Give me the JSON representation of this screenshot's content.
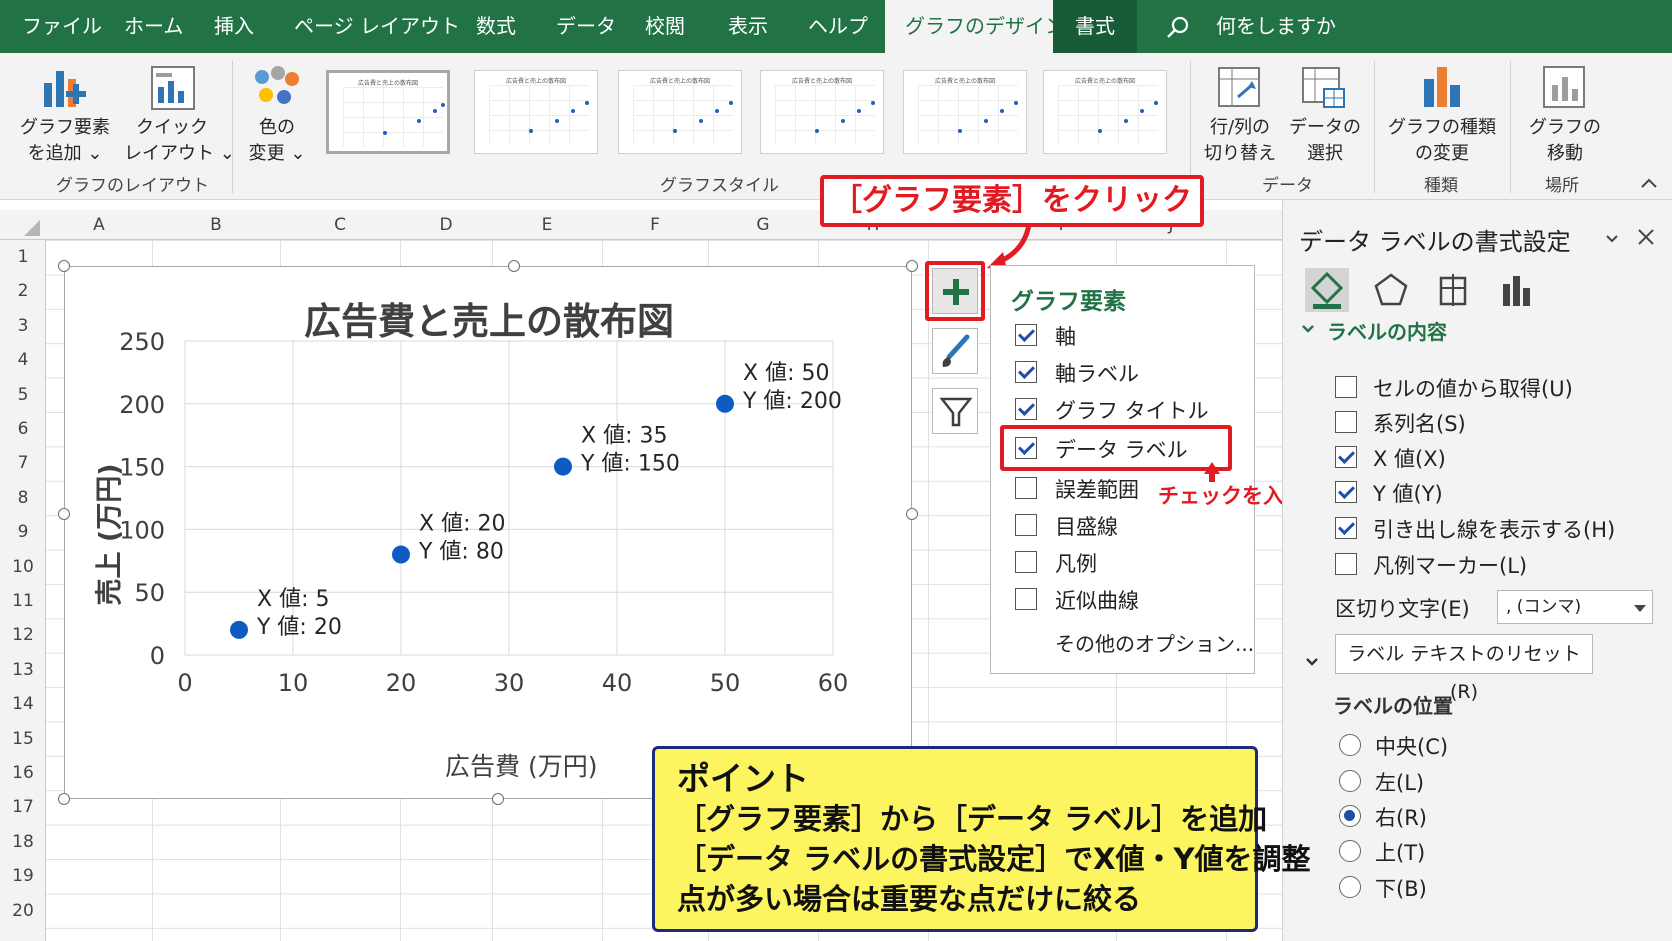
{
  "menu": {
    "items": [
      "ファイル",
      "ホーム",
      "挿入",
      "ページ レイアウト",
      "数式",
      "データ",
      "校閲",
      "表示",
      "ヘルプ"
    ],
    "active_tab": "グラフのデザイン",
    "format_tab": "書式",
    "search": "何をしますか"
  },
  "ribbon": {
    "add_element": [
      "グラフ要素",
      "を追加 ⌄"
    ],
    "quick_layout": [
      "クイック",
      "レイアウト ⌄"
    ],
    "change_color": [
      "色の",
      "変更 ⌄"
    ],
    "switch_row_col": [
      "行/列の",
      "切り替え"
    ],
    "select_data": [
      "データの",
      "選択"
    ],
    "change_type": [
      "グラフの種類",
      "の変更"
    ],
    "move_chart": [
      "グラフの",
      "移動"
    ],
    "group_layout": "グラフのレイアウト",
    "group_styles": "グラフスタイル",
    "group_data": "データ",
    "group_type": "種類",
    "group_location": "場所",
    "thumb_title": "広告費と売上の散布図"
  },
  "sheet": {
    "columns": [
      "A",
      "B",
      "C",
      "D",
      "E",
      "F",
      "G",
      "H",
      "I",
      "J"
    ],
    "rows": [
      "1",
      "2",
      "3",
      "4",
      "5",
      "6",
      "7",
      "8",
      "9",
      "10",
      "11",
      "12",
      "13",
      "14",
      "15",
      "16",
      "17",
      "18",
      "19",
      "20"
    ]
  },
  "chart_data": {
    "type": "scatter",
    "title": "広告費と売上の散布図",
    "xlabel": "広告費 (万円)",
    "ylabel": "売上 (万円)",
    "xlim": [
      0,
      60
    ],
    "ylim": [
      0,
      250
    ],
    "xticks": [
      0,
      10,
      20,
      30,
      40,
      50,
      60
    ],
    "yticks": [
      0,
      50,
      100,
      150,
      200,
      250
    ],
    "grid": true,
    "points": [
      {
        "x": 5,
        "y": 20,
        "label_x": "X 値: 5",
        "label_y": "Y 値: 20"
      },
      {
        "x": 20,
        "y": 80,
        "label_x": "X 値: 20",
        "label_y": "Y 値: 80"
      },
      {
        "x": 35,
        "y": 150,
        "label_x": "X 値: 35",
        "label_y": "Y 値: 150"
      },
      {
        "x": 50,
        "y": 200,
        "label_x": "X 値: 50",
        "label_y": "Y 値: 200"
      }
    ],
    "point_color": "#0f5bc4"
  },
  "popup": {
    "title": "グラフ要素",
    "items": [
      {
        "label": "軸",
        "checked": true
      },
      {
        "label": "軸ラベル",
        "checked": true
      },
      {
        "label": "グラフ タイトル",
        "checked": true
      },
      {
        "label": "データ ラベル",
        "checked": true
      },
      {
        "label": "誤差範囲",
        "checked": false
      },
      {
        "label": "目盛線",
        "checked": false
      },
      {
        "label": "凡例",
        "checked": false
      },
      {
        "label": "近似曲線",
        "checked": false
      }
    ],
    "more": "その他のオプション..."
  },
  "pane": {
    "title": "データ ラベルの書式設定",
    "section_content": "ラベルの内容",
    "options": [
      {
        "label": "セルの値から取得(U)",
        "checked": false
      },
      {
        "label": "系列名(S)",
        "checked": false
      },
      {
        "label": "X 値(X)",
        "checked": true
      },
      {
        "label": "Y 値(Y)",
        "checked": true
      },
      {
        "label": "引き出し線を表示する(H)",
        "checked": true
      },
      {
        "label": "凡例マーカー(L)",
        "checked": false
      }
    ],
    "separator_label": "区切り文字(E)",
    "separator_value": ", (コンマ)",
    "reset_button": "ラベル テキストのリセット(R)",
    "section_position": "ラベルの位置",
    "positions": [
      {
        "label": "中央(C)",
        "selected": false
      },
      {
        "label": "左(L)",
        "selected": false
      },
      {
        "label": "右(R)",
        "selected": true
      },
      {
        "label": "上(T)",
        "selected": false
      },
      {
        "label": "下(B)",
        "selected": false
      }
    ]
  },
  "callouts": {
    "click": "［グラフ要素］をクリック",
    "check": "チェックを入れる",
    "point_title": "ポイント",
    "point_lines": [
      "［グラフ要素］から［データ ラベル］を追加",
      "［データ ラベルの書式設定］でX値・Y値を調整",
      "点が多い場合は重要な点だけに絞る"
    ]
  },
  "colors": {
    "excel_green": "#217346",
    "callout_red": "#e21a22",
    "note_yellow": "#fdf55f"
  }
}
